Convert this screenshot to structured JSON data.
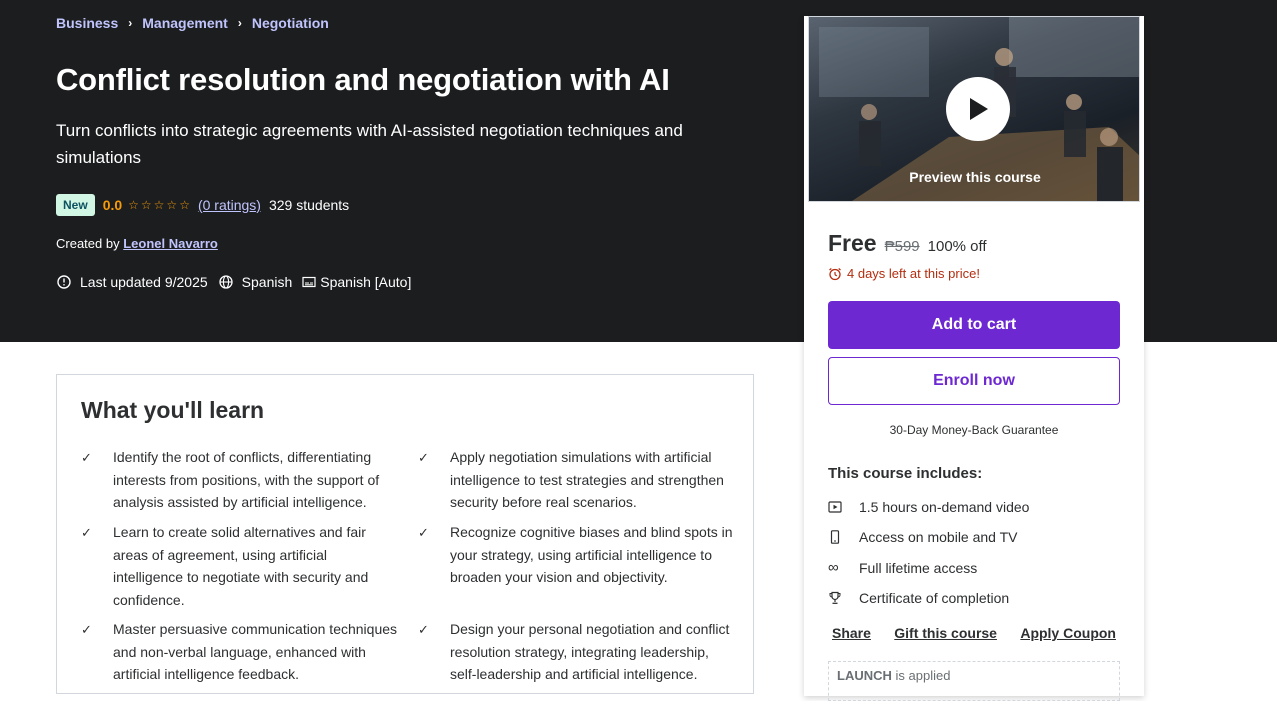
{
  "breadcrumb": [
    "Business",
    "Management",
    "Negotiation"
  ],
  "course": {
    "title": "Conflict resolution and negotiation with AI",
    "subtitle": "Turn conflicts into strategic agreements with AI-assisted negotiation techniques and simulations",
    "badge": "New",
    "rating": "0.0",
    "ratings_link": "(0 ratings)",
    "students": "329 students",
    "created_by_prefix": "Created by",
    "instructor": "Leonel Navarro",
    "last_updated": "Last updated 9/2025",
    "language": "Spanish",
    "captions": "Spanish [Auto]"
  },
  "learn": {
    "title": "What you'll learn",
    "items": [
      "Identify the root of conflicts, differentiating interests from positions, with the support of analysis assisted by artificial intelligence.",
      "Apply negotiation simulations with artificial intelligence to test strategies and strengthen security before real scenarios.",
      "Learn to create solid alternatives and fair areas of agreement, using artificial intelligence to negotiate with security and confidence.",
      "Recognize cognitive biases and blind spots in your strategy, using artificial intelligence to broaden your vision and objectivity.",
      "Master persuasive communication techniques and non-verbal language, enhanced with artificial intelligence feedback.",
      "Design your personal negotiation and conflict resolution strategy, integrating leadership, self-leadership and artificial intelligence."
    ]
  },
  "sidebar": {
    "preview_label": "Preview this course",
    "price": "Free",
    "original_price": "₱599",
    "discount": "100% off",
    "timer": "4 days left at this price!",
    "add_to_cart": "Add to cart",
    "enroll_now": "Enroll now",
    "guarantee": "30-Day Money-Back Guarantee",
    "includes_title": "This course includes:",
    "includes": [
      {
        "icon": "video-icon",
        "label": "1.5 hours on-demand video"
      },
      {
        "icon": "mobile-icon",
        "label": "Access on mobile and TV"
      },
      {
        "icon": "infinity-icon",
        "label": "Full lifetime access"
      },
      {
        "icon": "trophy-icon",
        "label": "Certificate of completion"
      }
    ],
    "share": "Share",
    "gift": "Gift this course",
    "apply_coupon": "Apply Coupon",
    "coupon_code": "LAUNCH",
    "coupon_status": "is applied"
  },
  "colors": {
    "hero_bg": "#1c1d1f",
    "accent_purple": "#6d28d2",
    "link_purple": "#c0c4fc",
    "star_orange": "#f69c08",
    "timer_red": "#b32d0f",
    "badge_green": "#d2f6e4"
  }
}
